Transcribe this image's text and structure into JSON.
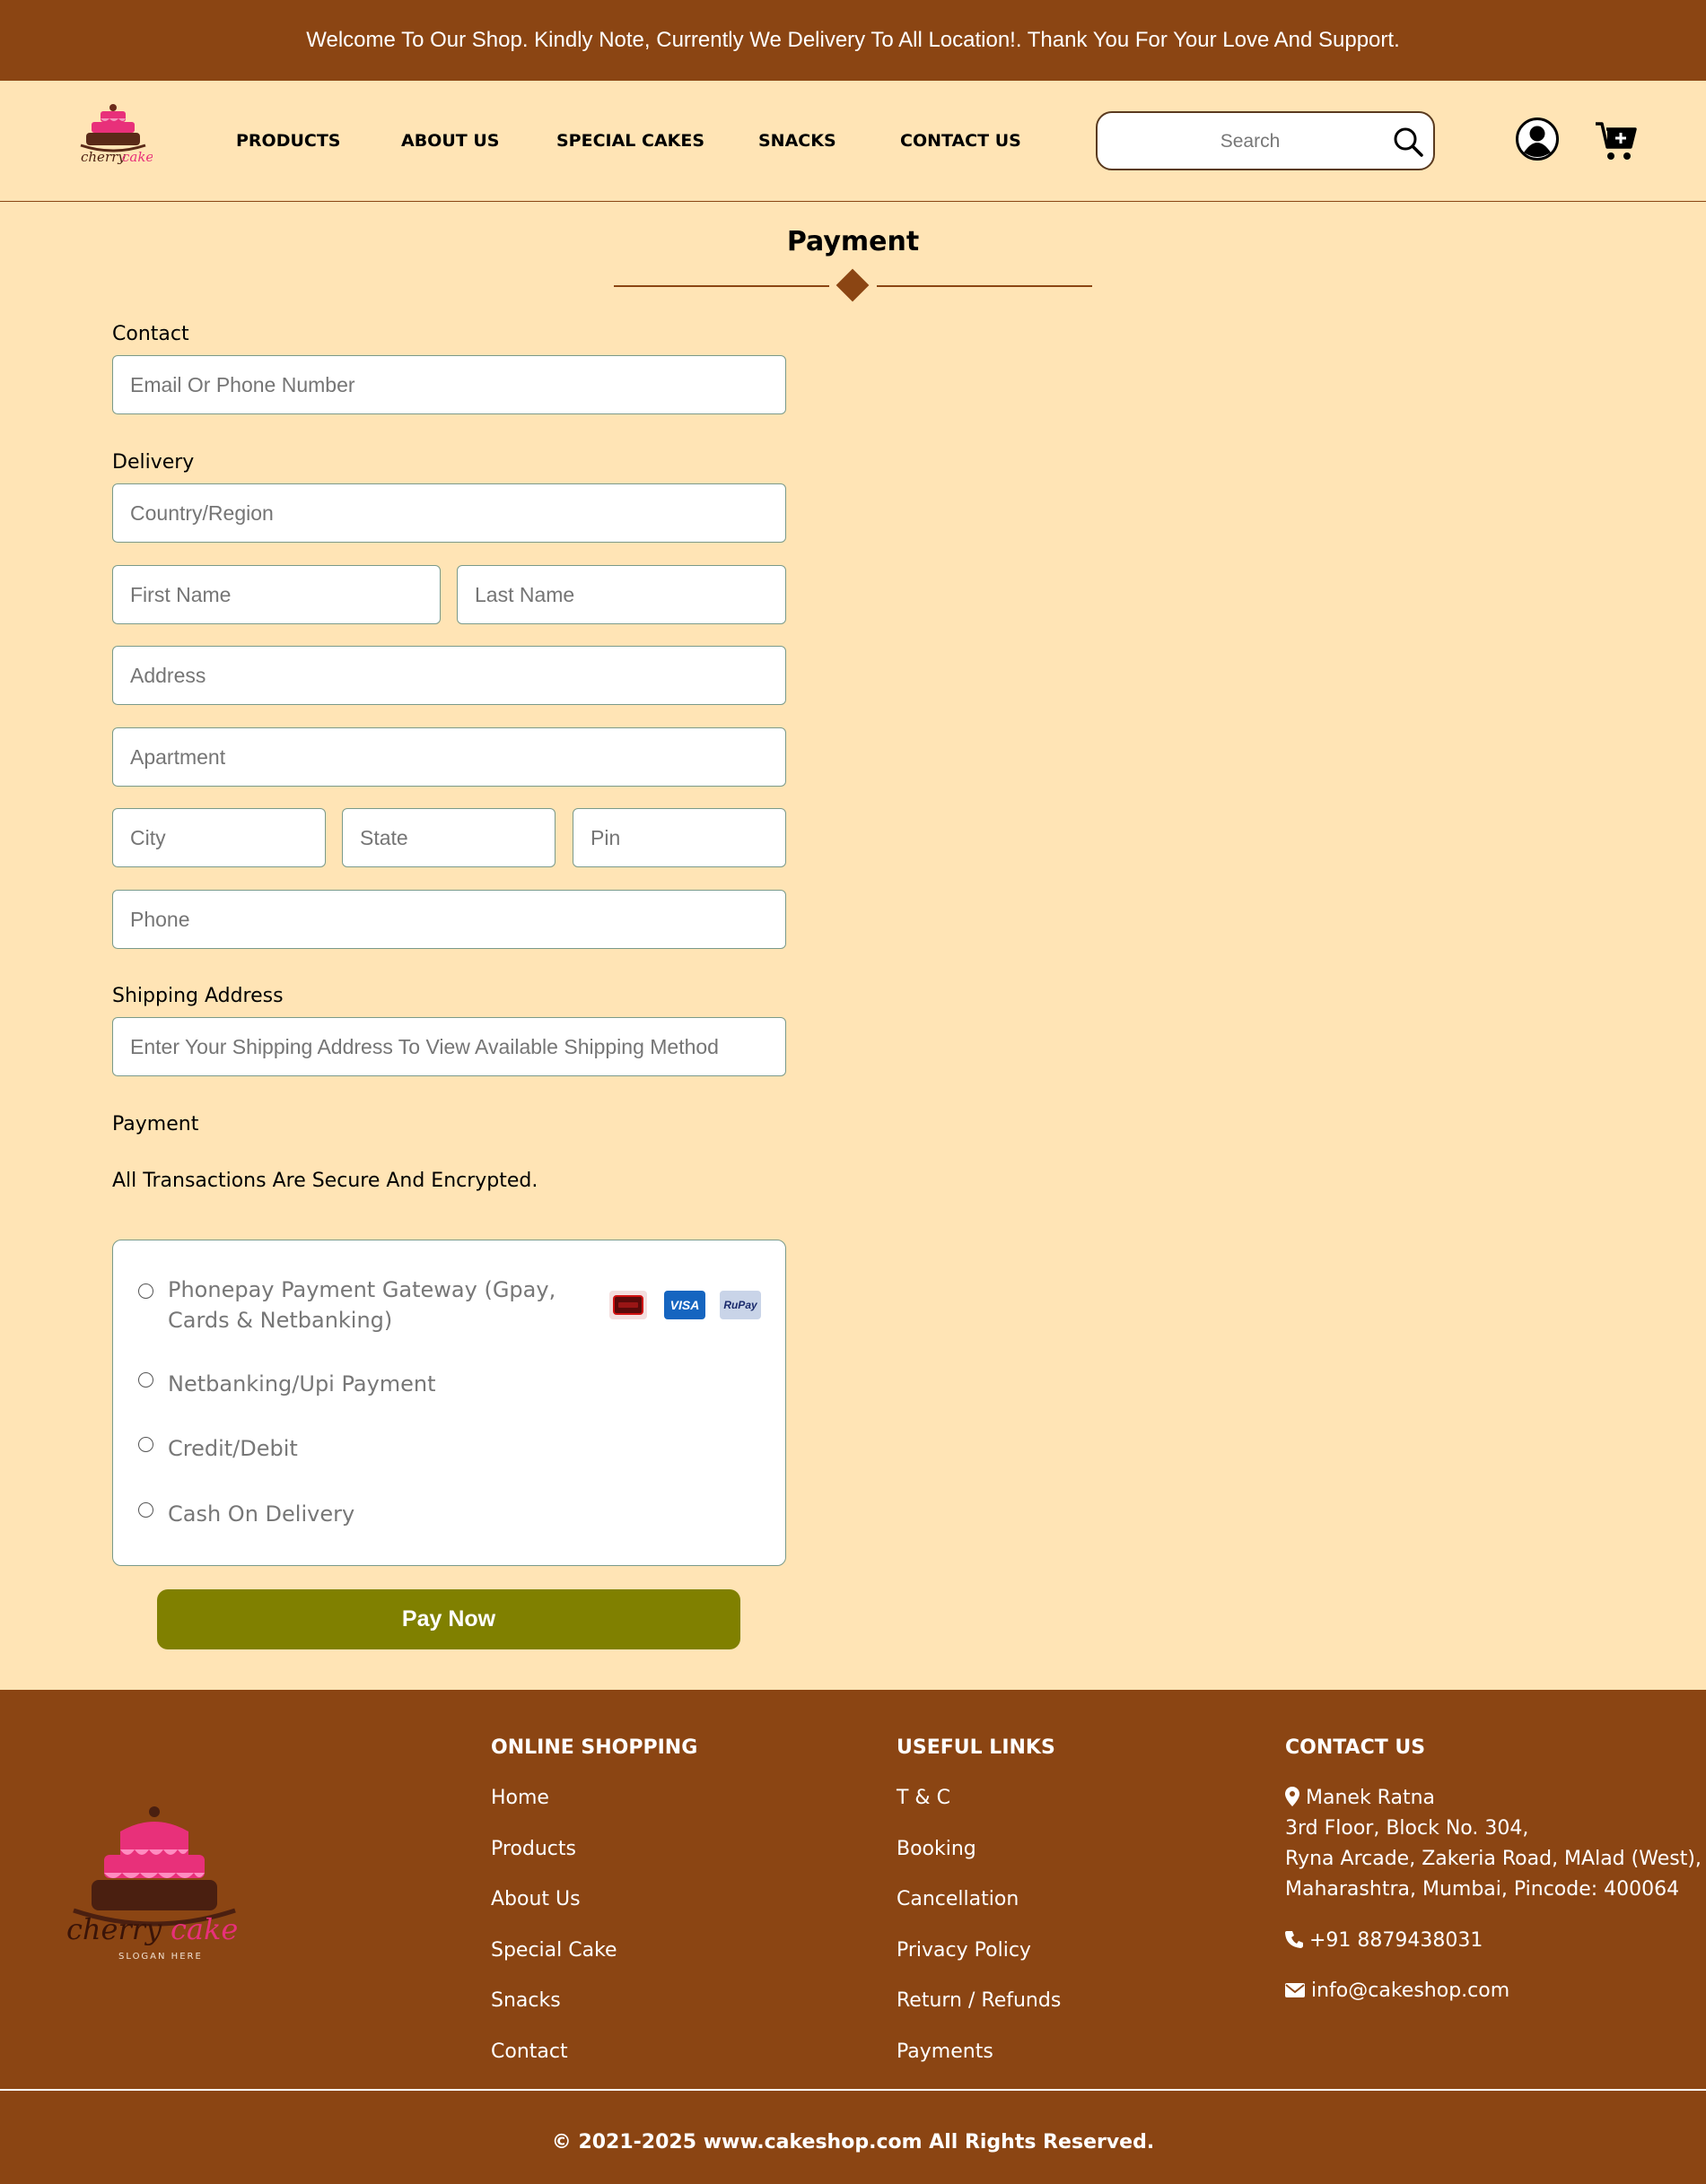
{
  "announcement": "Welcome To Our Shop. Kindly Note, Currently We Delivery To All Location!. Thank You For Your Love And Support.",
  "header": {
    "logo_text": "cherry cake",
    "nav": [
      "PRODUCTS",
      "ABOUT US",
      "SPECIAL CAKES",
      "SNACKS",
      "CONTACT US"
    ],
    "search_placeholder": "Search",
    "icons": [
      "search-icon",
      "user-icon",
      "cart-icon"
    ]
  },
  "page": {
    "title": "Payment"
  },
  "form": {
    "contact_label": "Contact",
    "contact_placeholder": "Email Or Phone Number",
    "delivery_label": "Delivery",
    "country_placeholder": "Country/Region",
    "first_name_placeholder": "First Name",
    "last_name_placeholder": "Last Name",
    "address_placeholder": "Address",
    "apartment_placeholder": "Apartment",
    "city_placeholder": "City",
    "state_placeholder": "State",
    "pin_placeholder": "Pin",
    "phone_placeholder": "Phone",
    "shipping_label": "Shipping Address",
    "shipping_placeholder": "Enter Your Shipping Address To View Available Shipping Method",
    "payment_label": "Payment",
    "secure_text": "All Transactions Are Secure And Encrypted.",
    "payment_options": [
      "Phonepay Payment Gateway (Gpay, Cards & Netbanking)",
      "Netbanking/Upi Payment",
      "Credit/Debit",
      "Cash On Delivery"
    ],
    "card_badges": [
      "mastercard",
      "VISA",
      "RuPay"
    ],
    "pay_button": "Pay Now"
  },
  "footer": {
    "logo_text": "cherry cake",
    "logo_slogan": "SLOGAN HERE",
    "online_shopping": {
      "title": "ONLINE SHOPPING",
      "links": [
        "Home",
        "Products",
        "About Us",
        "Special Cake",
        "Snacks",
        "Contact"
      ]
    },
    "useful_links": {
      "title": "USEFUL LINKS",
      "links": [
        "T & C",
        "Booking",
        "Cancellation",
        "Privacy Policy",
        "Return / Refunds",
        "Payments"
      ]
    },
    "contact": {
      "title": "CONTACT US",
      "address_lines": [
        "Manek Ratna",
        "3rd Floor, Block No. 304,",
        "Ryna Arcade, Zakeria Road, MAlad (West),",
        "Maharashtra, Mumbai, Pincode: 400064"
      ],
      "phone": "+91 8879438031",
      "email": "info@cakeshop.com"
    },
    "copyright": "© 2021-2025 www.cakeshop.com All Rights Reserved."
  },
  "colors": {
    "brown": "#8B4513",
    "cream": "#FFE4B5",
    "olive_button": "#808000",
    "pink": "#E8307A"
  }
}
